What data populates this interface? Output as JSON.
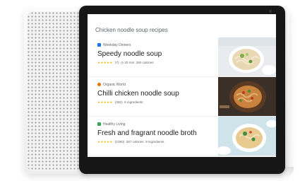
{
  "screen": {
    "title": "Chicken noodle soup recipes"
  },
  "recipes": [
    {
      "source": "Weekday Dinners",
      "source_color": "#1a73e8",
      "title": "Speedy noodle soup",
      "stars": "★★★★★",
      "rating_count": "(7)",
      "time": "20 min",
      "calories": "280 calories",
      "thumb_icon": "noodle-bowl-photo"
    },
    {
      "source": "Organic World",
      "source_color": "#e37400",
      "title": "Chilli chicken noodle soup",
      "stars": "★★★★★",
      "rating_count": "(392)",
      "ingredients": "6 ingredients",
      "thumb_icon": "chilli-noodle-photo"
    },
    {
      "source": "Healthy Living",
      "source_color": "#34a853",
      "title": "Fresh and fragrant noodle broth",
      "stars": "★★★★★",
      "rating_count": "(1080)",
      "calories": "287 calories",
      "ingredients": "9 ingredients",
      "thumb_icon": "broth-bowl-photo"
    }
  ]
}
